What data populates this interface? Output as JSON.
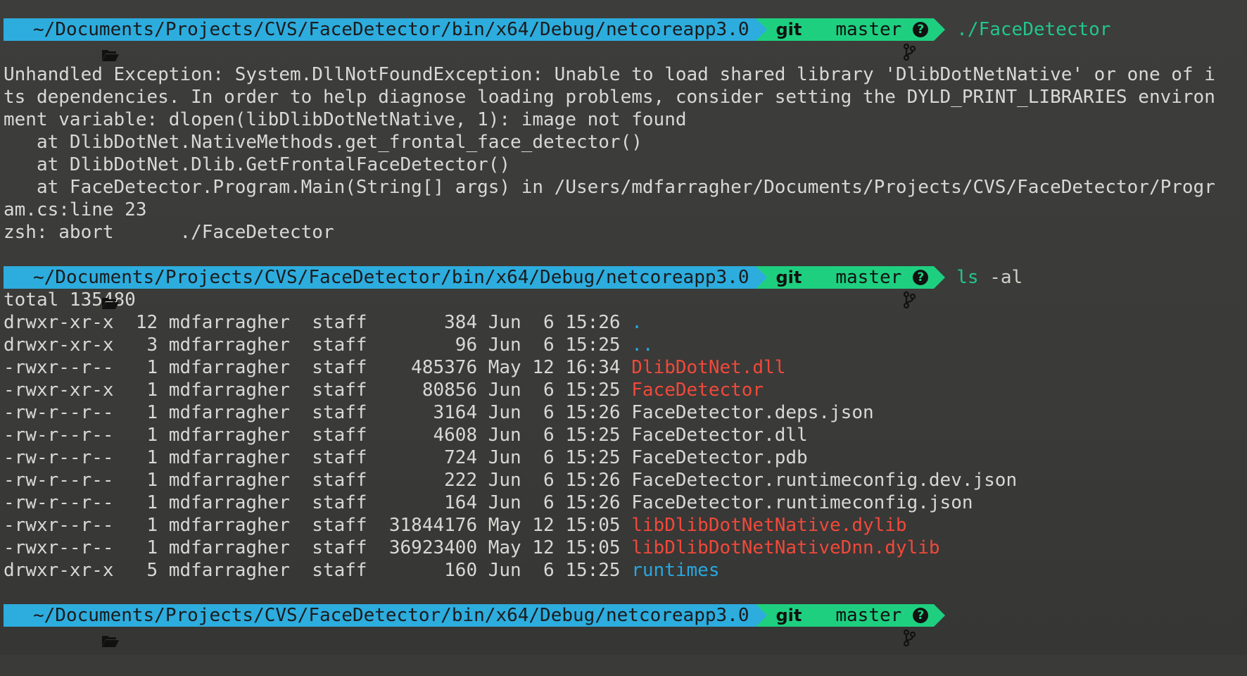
{
  "prompt": {
    "path": "~/Documents/Projects/CVS/FaceDetector/bin/x64/Debug/netcoreapp3.0",
    "git_label": "git",
    "branch": "master",
    "status_symbol": "?",
    "colors": {
      "path_bg": "#2dacde",
      "git_bg": "#1fcf80",
      "command": "#22c78a"
    }
  },
  "commands": {
    "first": "./FaceDetector",
    "second_cmd": "ls",
    "second_args": "-al"
  },
  "error_output": [
    "Unhandled Exception: System.DllNotFoundException: Unable to load shared library 'DlibDotNetNative' or one of i",
    "ts dependencies. In order to help diagnose loading problems, consider setting the DYLD_PRINT_LIBRARIES environ",
    "ment variable: dlopen(libDlibDotNetNative, 1): image not found",
    "   at DlibDotNet.NativeMethods.get_frontal_face_detector()",
    "   at DlibDotNet.Dlib.GetFrontalFaceDetector()",
    "   at FaceDetector.Program.Main(String[] args) in /Users/mdfarragher/Documents/Projects/CVS/FaceDetector/Progr",
    "am.cs:line 23",
    "zsh: abort      ./FaceDetector"
  ],
  "ls": {
    "total": "total 135480",
    "rows": [
      {
        "meta": "drwxr-xr-x  12 mdfarragher  staff       384 Jun  6 15:26 ",
        "name": ".",
        "kind": "dir"
      },
      {
        "meta": "drwxr-xr-x   3 mdfarragher  staff        96 Jun  6 15:25 ",
        "name": "..",
        "kind": "dir"
      },
      {
        "meta": "-rwxr--r--   1 mdfarragher  staff    485376 May 12 16:34 ",
        "name": "DlibDotNet.dll",
        "kind": "exec"
      },
      {
        "meta": "-rwxr-xr-x   1 mdfarragher  staff     80856 Jun  6 15:25 ",
        "name": "FaceDetector",
        "kind": "exec"
      },
      {
        "meta": "-rw-r--r--   1 mdfarragher  staff      3164 Jun  6 15:26 ",
        "name": "FaceDetector.deps.json",
        "kind": "plain"
      },
      {
        "meta": "-rw-r--r--   1 mdfarragher  staff      4608 Jun  6 15:25 ",
        "name": "FaceDetector.dll",
        "kind": "plain"
      },
      {
        "meta": "-rw-r--r--   1 mdfarragher  staff       724 Jun  6 15:25 ",
        "name": "FaceDetector.pdb",
        "kind": "plain"
      },
      {
        "meta": "-rw-r--r--   1 mdfarragher  staff       222 Jun  6 15:26 ",
        "name": "FaceDetector.runtimeconfig.dev.json",
        "kind": "plain"
      },
      {
        "meta": "-rw-r--r--   1 mdfarragher  staff       164 Jun  6 15:26 ",
        "name": "FaceDetector.runtimeconfig.json",
        "kind": "plain"
      },
      {
        "meta": "-rwxr--r--   1 mdfarragher  staff  31844176 May 12 15:05 ",
        "name": "libDlibDotNetNative.dylib",
        "kind": "exec"
      },
      {
        "meta": "-rwxr--r--   1 mdfarragher  staff  36923400 May 12 15:05 ",
        "name": "libDlibDotNetNativeDnn.dylib",
        "kind": "exec"
      },
      {
        "meta": "drwxr-xr-x   5 mdfarragher  staff       160 Jun  6 15:25 ",
        "name": "runtimes",
        "kind": "dir"
      }
    ]
  }
}
